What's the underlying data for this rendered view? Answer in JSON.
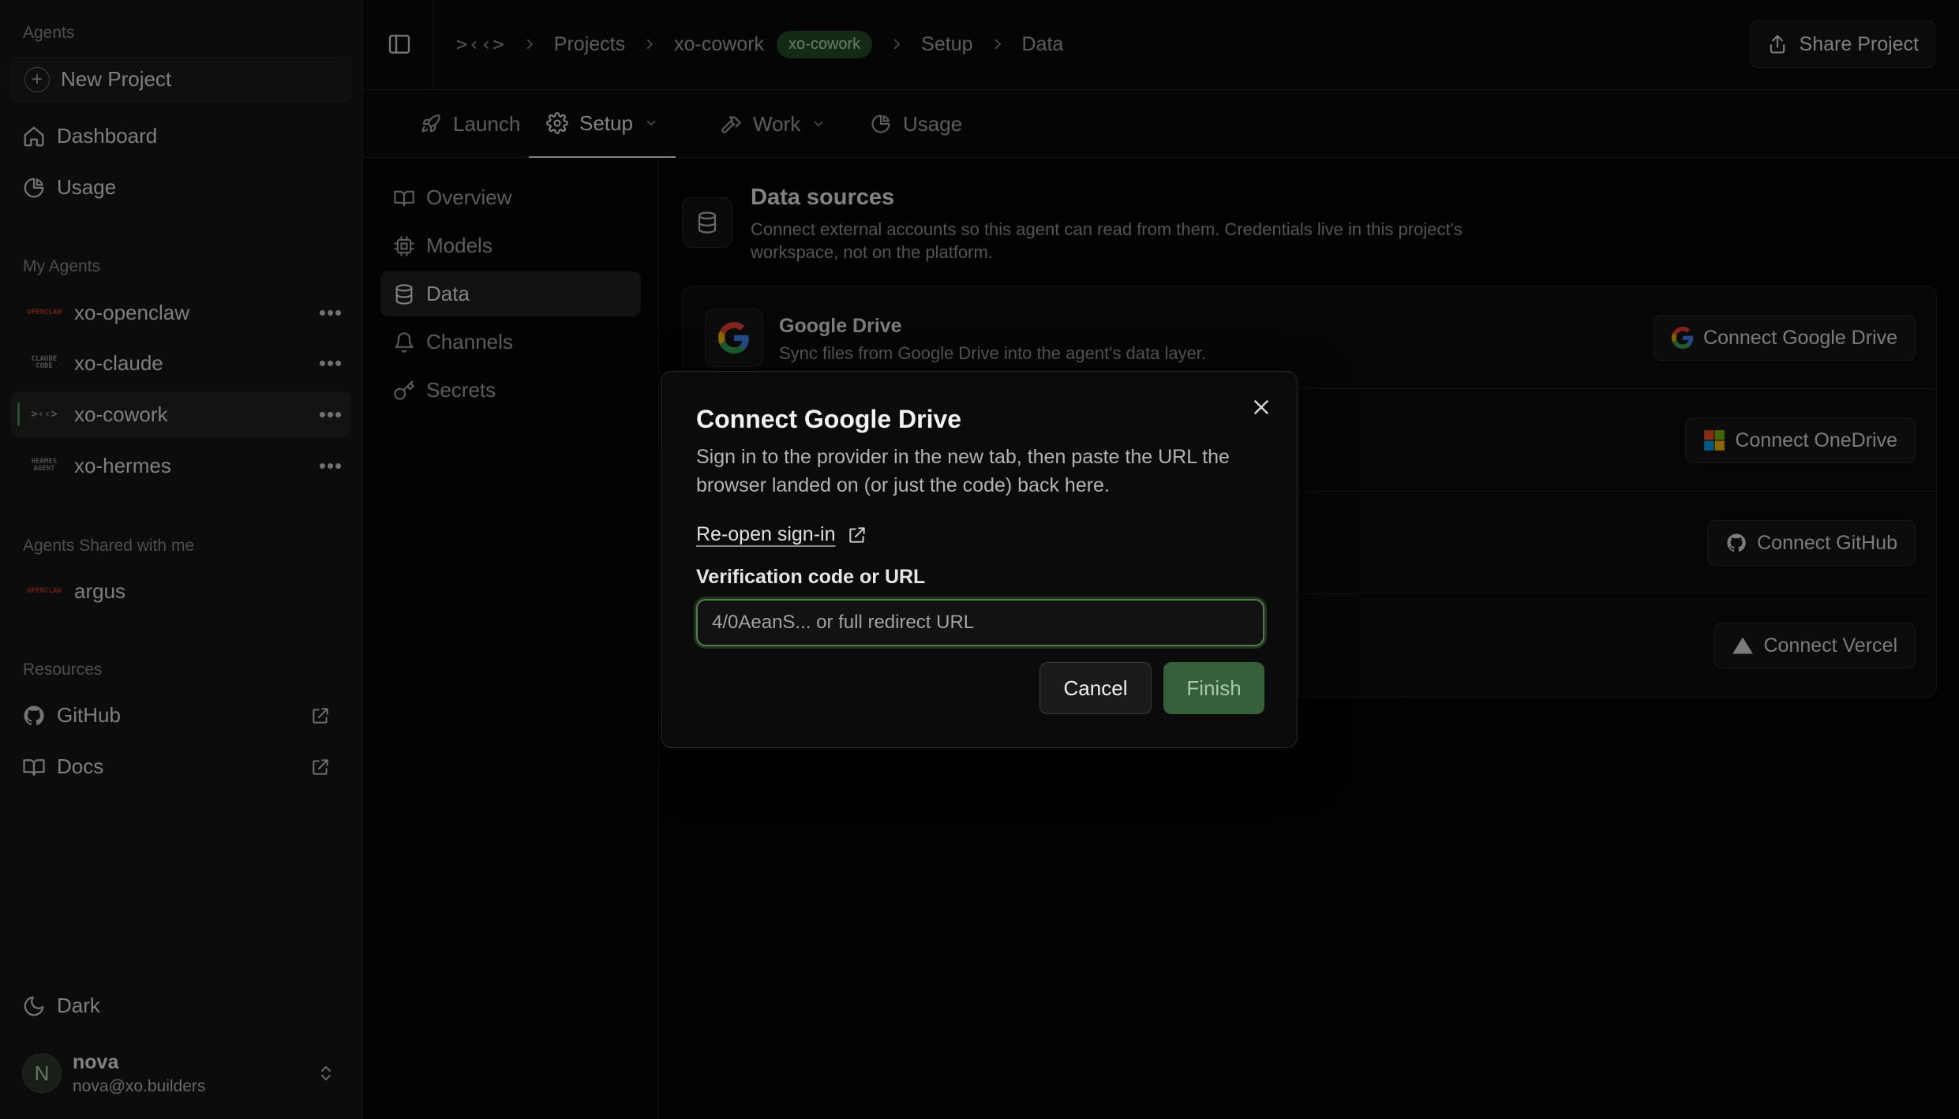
{
  "sidebar": {
    "agents_label": "Agents",
    "new_project": "New Project",
    "nav": [
      {
        "label": "Dashboard",
        "icon": "home-icon"
      },
      {
        "label": "Usage",
        "icon": "pie-chart-icon"
      }
    ],
    "my_agents_label": "My Agents",
    "my_agents": [
      {
        "name": "xo-openclaw",
        "logo": "OPENCLAW"
      },
      {
        "name": "xo-claude",
        "logo": "CLAUDE CODE"
      },
      {
        "name": "xo-cowork",
        "logo": ">‹‹>"
      },
      {
        "name": "xo-hermes",
        "logo": "HERMES AGENT"
      }
    ],
    "shared_label": "Agents Shared with me",
    "shared_agents": [
      {
        "name": "argus",
        "logo": "OPENCLAW"
      }
    ],
    "resources_label": "Resources",
    "resources": [
      {
        "label": "GitHub",
        "icon": "github-icon"
      },
      {
        "label": "Docs",
        "icon": "book-icon"
      }
    ],
    "theme_label": "Dark",
    "user": {
      "initial": "N",
      "name": "nova",
      "email": "nova@xo.builders"
    }
  },
  "topbar": {
    "brand": ">‹‹>",
    "breadcrumbs": [
      "Projects",
      "xo-cowork",
      "Setup",
      "Data"
    ],
    "badge": "xo-cowork",
    "share_label": "Share Project"
  },
  "tabs": [
    {
      "label": "Launch",
      "icon": "rocket-icon"
    },
    {
      "label": "Setup",
      "icon": "gear-icon",
      "active": true
    },
    {
      "label": "Work",
      "icon": "hammer-icon"
    },
    {
      "label": "Usage",
      "icon": "pie-chart-icon"
    }
  ],
  "subnav": [
    {
      "label": "Overview",
      "icon": "book-open-icon"
    },
    {
      "label": "Models",
      "icon": "cpu-icon"
    },
    {
      "label": "Data",
      "icon": "database-icon",
      "active": true
    },
    {
      "label": "Channels",
      "icon": "bell-icon"
    },
    {
      "label": "Secrets",
      "icon": "key-icon"
    }
  ],
  "data_sources": {
    "title": "Data sources",
    "description": "Connect external accounts so this agent can read from them. Credentials live in this project's workspace, not on the platform.",
    "providers": [
      {
        "name": "Google Drive",
        "description": "Sync files from Google Drive into the agent's data layer.",
        "button": "Connect Google Drive"
      },
      {
        "name": "OneDrive",
        "description": "",
        "button": "Connect OneDrive"
      },
      {
        "name": "GitHub",
        "description": "",
        "button": "Connect GitHub"
      },
      {
        "name": "Vercel",
        "description": "",
        "button": "Connect Vercel"
      }
    ]
  },
  "dialog": {
    "title": "Connect Google Drive",
    "description": "Sign in to the provider in the new tab, then paste the URL the browser landed on (or just the code) back here.",
    "reopen_label": "Re-open sign-in",
    "field_label": "Verification code or URL",
    "field_placeholder": "4/0AeanS... or full redirect URL",
    "field_value": "",
    "cancel_label": "Cancel",
    "finish_label": "Finish"
  },
  "colors": {
    "accent": "#36603a",
    "accent_focus": "#4f7d49",
    "badge_bg": "#264d29",
    "background": "#000000",
    "sidebar_bg": "#161616"
  }
}
